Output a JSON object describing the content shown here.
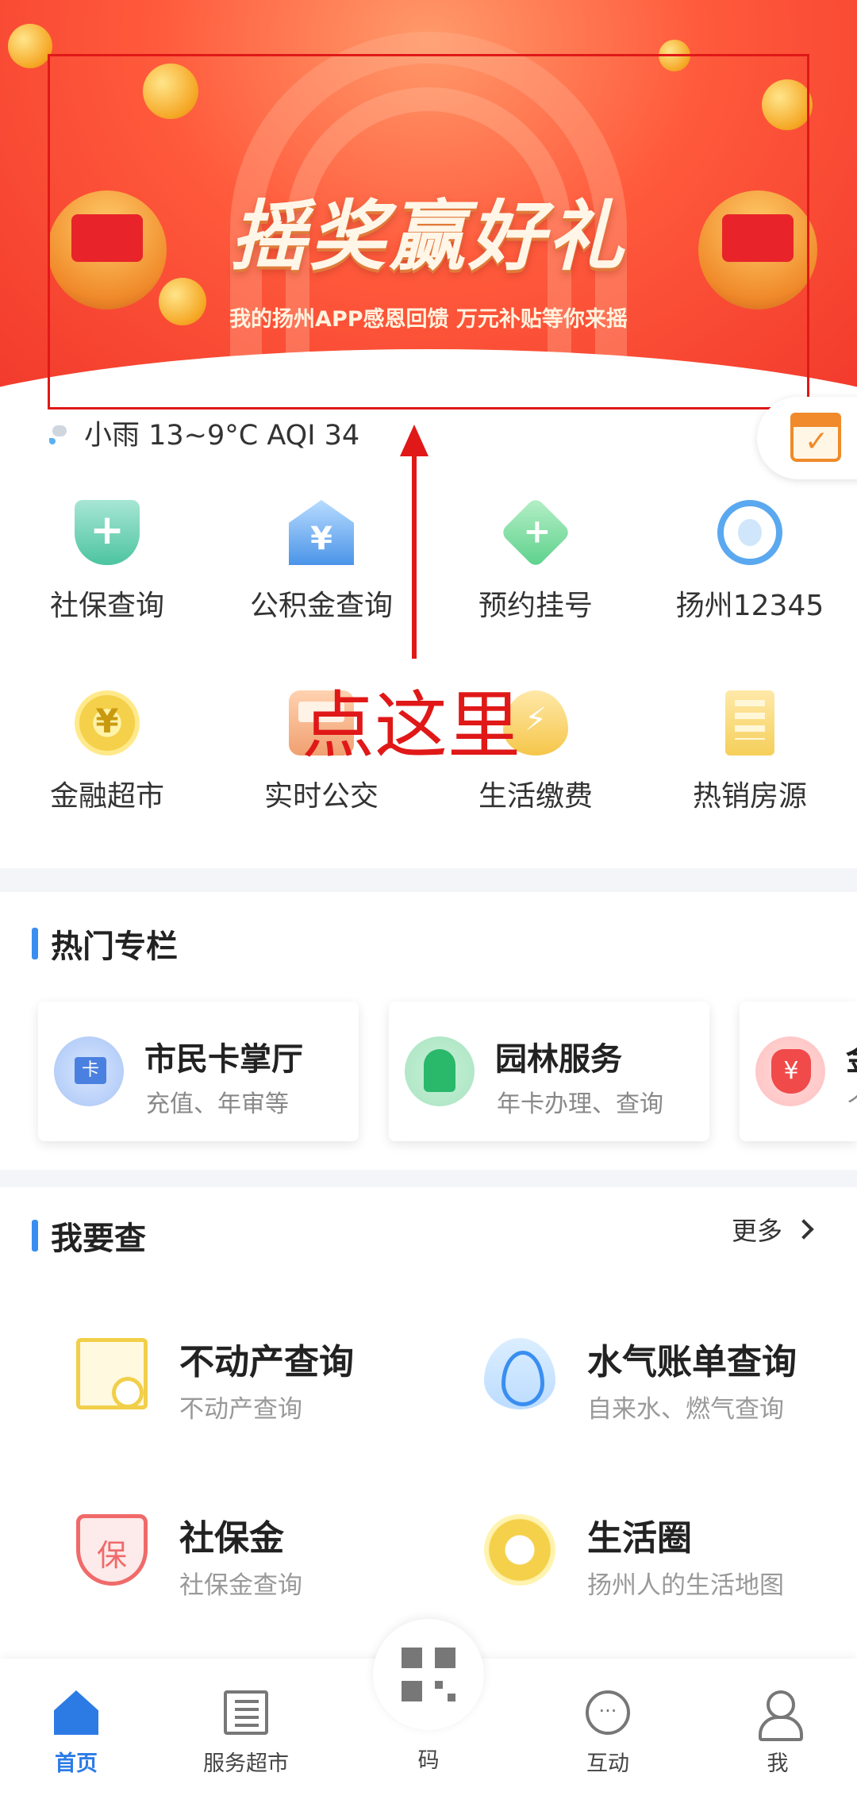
{
  "banner": {
    "title": "摇奖赢好礼",
    "subtitle": "我的扬州APP感恩回馈 万元补贴等你来摇"
  },
  "weather": {
    "text": "小雨 13~9°C AQI 34",
    "icon": "light-rain-icon"
  },
  "services": [
    {
      "label": "社保查询",
      "icon": "shield-plus-icon"
    },
    {
      "label": "公积金查询",
      "icon": "house-yen-icon"
    },
    {
      "label": "预约挂号",
      "icon": "medical-clock-icon"
    },
    {
      "label": "扬州12345",
      "icon": "headset-icon"
    },
    {
      "label": "金融超市",
      "icon": "yen-coin-icon"
    },
    {
      "label": "实时公交",
      "icon": "bus-icon"
    },
    {
      "label": "生活缴费",
      "icon": "lightning-drop-icon"
    },
    {
      "label": "热销房源",
      "icon": "building-icon"
    }
  ],
  "annotation": {
    "text": "点这里",
    "color": "#e01818"
  },
  "hot_section": {
    "title": "热门专栏",
    "cards": [
      {
        "title": "市民卡掌厅",
        "subtitle": "充值、年审等",
        "icon": "citizen-card-icon"
      },
      {
        "title": "园林服务",
        "subtitle": "年卡办理、查询",
        "icon": "tree-icon"
      },
      {
        "title": "金",
        "subtitle": "个",
        "icon": "money-bag-icon"
      }
    ]
  },
  "query_section": {
    "title": "我要查",
    "more": "更多",
    "items": [
      {
        "title": "不动产查询",
        "subtitle": "不动产查询",
        "icon": "property-search-icon"
      },
      {
        "title": "水气账单查询",
        "subtitle": "自来水、燃气查询",
        "icon": "flame-icon"
      },
      {
        "title": "社保金",
        "subtitle": "社保金查询",
        "icon": "insurance-shield-icon"
      },
      {
        "title": "生活圈",
        "subtitle": "扬州人的生活地图",
        "icon": "life-circle-icon"
      }
    ]
  },
  "bottom_nav": {
    "items": [
      {
        "label": "首页",
        "icon": "home-icon",
        "active": true
      },
      {
        "label": "服务超市",
        "icon": "building-icon"
      },
      {
        "label": "码",
        "icon": "qr-code-icon"
      },
      {
        "label": "互动",
        "icon": "chat-icon"
      },
      {
        "label": "我",
        "icon": "user-icon"
      }
    ]
  },
  "colors": {
    "accent": "#2c7be5",
    "banner": "#f23a2c",
    "annotation": "#e01818"
  }
}
